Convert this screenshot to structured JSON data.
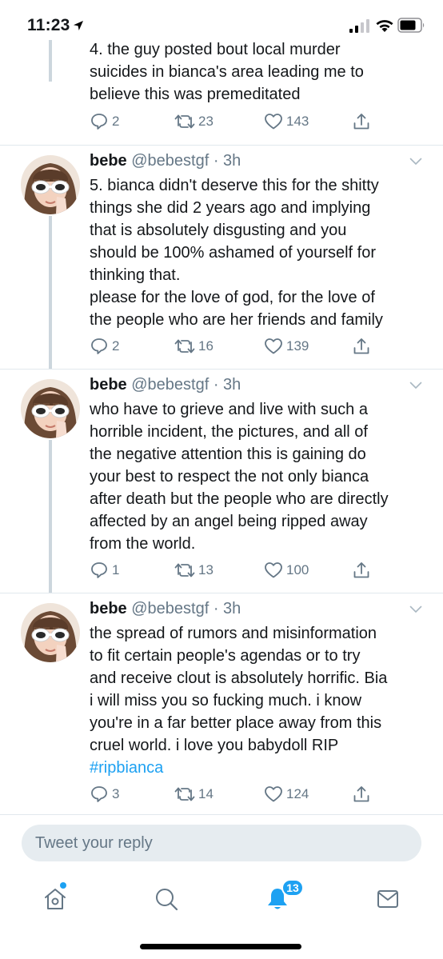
{
  "status_bar": {
    "time": "11:23"
  },
  "colors": {
    "accent": "#1da1f2",
    "text": "#14171a",
    "secondary": "#657786",
    "divider": "#e1e8ed"
  },
  "tweets": [
    {
      "lines": [
        "4. the guy posted bout local murder",
        "suicides in bianca's area leading me to",
        "believe this was premeditated"
      ],
      "replies": "2",
      "retweets": "23",
      "likes": "143"
    },
    {
      "name": "bebe",
      "handle": "@bebestgf",
      "time": "· 3h",
      "lines": [
        "5. bianca didn't deserve this for the shitty",
        "things she did 2 years ago and implying",
        "that is absolutely disgusting and you",
        "should be 100% ashamed of yourself for",
        "thinking that.",
        "please for the love of god, for the love of",
        "the people who are her friends and family"
      ],
      "replies": "2",
      "retweets": "16",
      "likes": "139"
    },
    {
      "name": "bebe",
      "handle": "@bebestgf",
      "time": "· 3h",
      "lines": [
        "who have to grieve and live with such a",
        "horrible incident, the pictures, and all of",
        "the negative attention this is gaining do",
        "your best to respect the not only bianca",
        "after death but the people who are directly",
        "affected by an angel being ripped away",
        "from the world."
      ],
      "replies": "1",
      "retweets": "13",
      "likes": "100"
    },
    {
      "name": "bebe",
      "handle": "@bebestgf",
      "time": "· 3h",
      "lines": [
        "the spread of rumors and misinformation",
        "to fit certain people's agendas or to try",
        "and receive clout is absolutely horrific. Bia",
        "i will miss you so fucking much. i know",
        "you're in a far better place away from this",
        "cruel world. i love you babydoll RIP"
      ],
      "hashtag": "#ripbianca",
      "replies": "3",
      "retweets": "14",
      "likes": "124"
    }
  ],
  "reply_bar": {
    "placeholder": "Tweet your reply"
  },
  "tab_bar": {
    "tabs": [
      {
        "name": "home",
        "icon": "home-icon"
      },
      {
        "name": "search",
        "icon": "search-icon"
      },
      {
        "name": "notifications",
        "icon": "bell-icon"
      },
      {
        "name": "messages",
        "icon": "envelope-icon"
      }
    ],
    "notification_count": "13"
  }
}
